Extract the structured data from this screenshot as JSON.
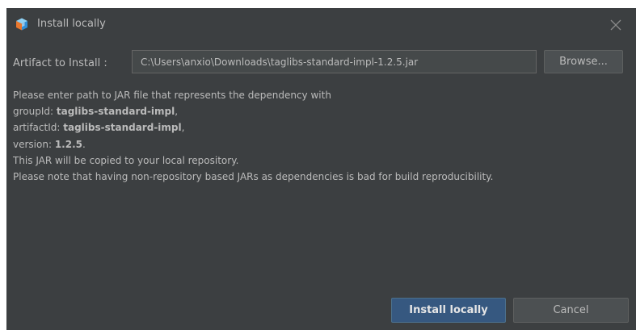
{
  "window": {
    "title": "Install locally",
    "app_icon": "netbeans-cube-icon",
    "close_icon": "close-icon"
  },
  "form": {
    "artifact_label": "Artifact to Install :",
    "path_value": "C:\\Users\\anxio\\Downloads\\taglibs-standard-impl-1.2.5.jar",
    "browse_label": "Browse..."
  },
  "message": {
    "line1": "Please enter path to JAR file that represents the dependency with",
    "group_label": "groupId: ",
    "group_value": "taglibs-standard-impl",
    "artifact_label": "artifactId: ",
    "artifact_value": "taglibs-standard-impl",
    "version_label": "version: ",
    "version_value": "1.2.5",
    "comma": ",",
    "period": ".",
    "line5": "This JAR will be copied to your local repository.",
    "line6": "Please note that having non-repository based JARs as dependencies is bad for build reproducibility."
  },
  "actions": {
    "install_label": "Install locally",
    "cancel_label": "Cancel"
  },
  "colors": {
    "background": "#3c3f41",
    "text": "#bbbbbb",
    "primary_button": "#365880",
    "button": "#4c5052",
    "input_background": "#45494a"
  }
}
